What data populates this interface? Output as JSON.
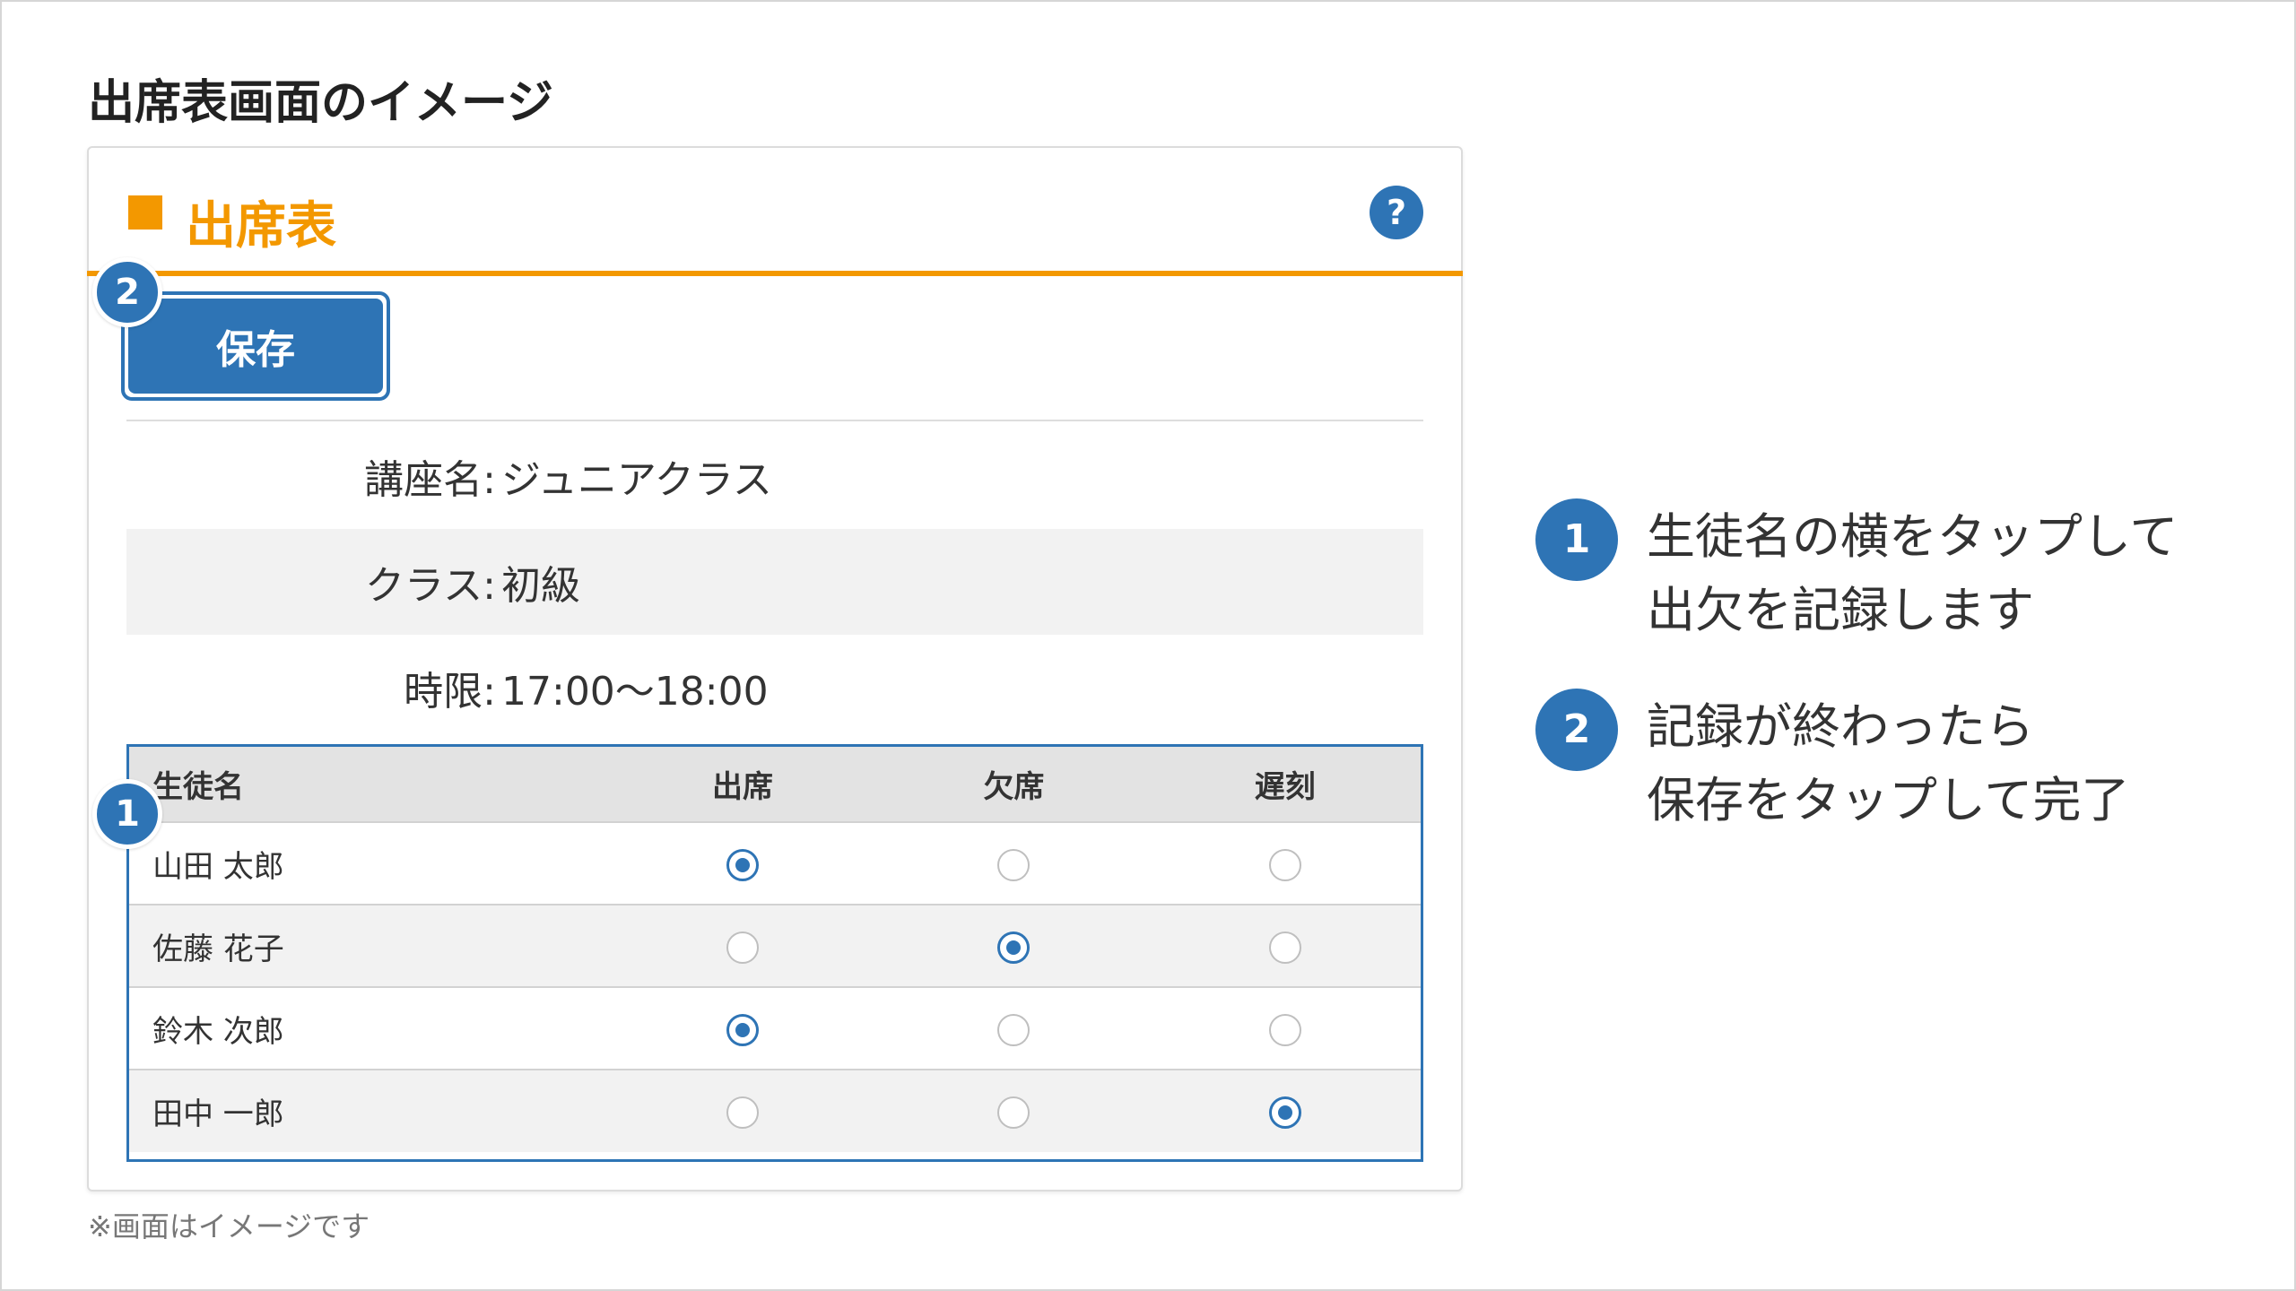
{
  "page": {
    "heading": "出席表画面のイメージ",
    "footnote": "※画面はイメージです"
  },
  "card": {
    "title": "出席表",
    "help_label": "?",
    "save_label": "保存",
    "accent_color": "#f39800",
    "primary_color": "#2e74b5"
  },
  "info": [
    {
      "label": "講座名:",
      "value": "ジュニアクラス"
    },
    {
      "label": "クラス:",
      "value": "初級"
    },
    {
      "label": "時限:",
      "value": "17:00〜18:00"
    }
  ],
  "table": {
    "headers": [
      "生徒名",
      "出席",
      "欠席",
      "遅刻"
    ],
    "rows": [
      {
        "name": "山田 太郎",
        "selected": "出席"
      },
      {
        "name": "佐藤 花子",
        "selected": "欠席"
      },
      {
        "name": "鈴木 次郎",
        "selected": "出席"
      },
      {
        "name": "田中 一郎",
        "selected": "遅刻"
      }
    ]
  },
  "badges": {
    "one": "1",
    "two": "2"
  },
  "steps": [
    {
      "number": "1",
      "line1": "生徒名の横をタップして",
      "line2": "出欠を記録します"
    },
    {
      "number": "2",
      "line1": "記録が終わったら",
      "line2": "保存をタップして完了"
    }
  ]
}
